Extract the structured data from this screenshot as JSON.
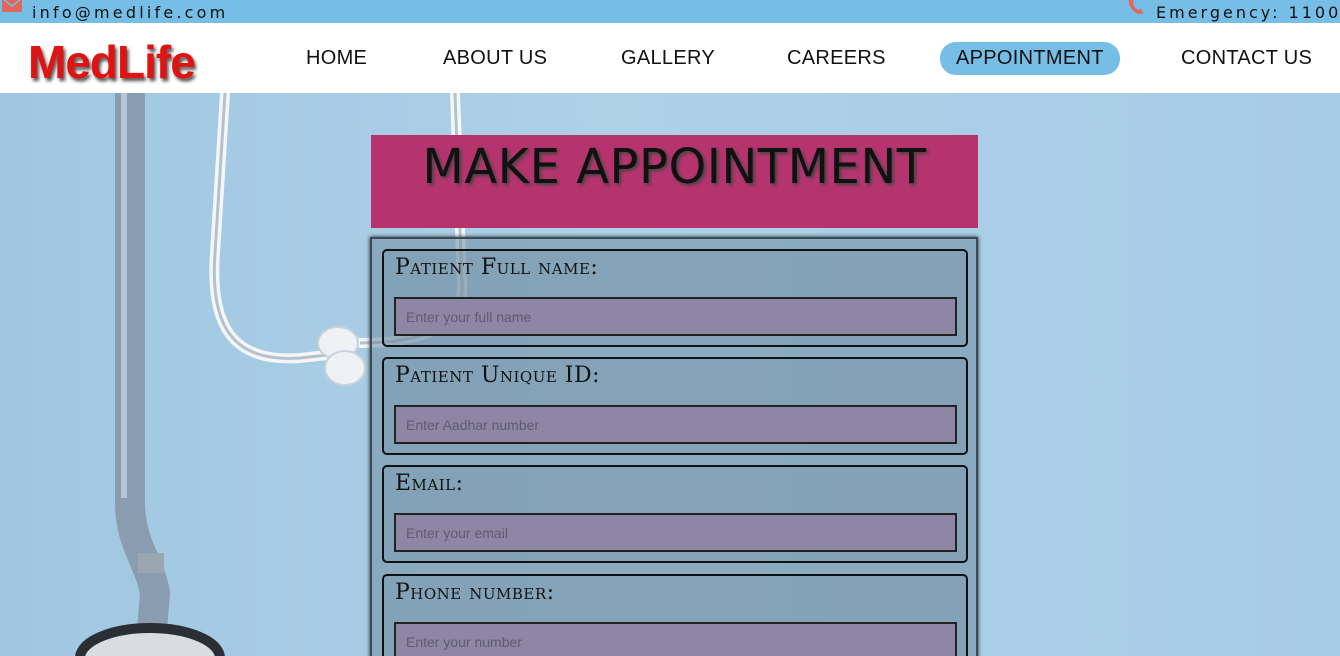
{
  "topbar": {
    "email": "info@medlife.com",
    "emergency": "Emergency: 1100",
    "mail_icon": "mail-icon",
    "phone_icon": "phone-icon"
  },
  "brand": {
    "name": "MedLife"
  },
  "nav": {
    "items": [
      {
        "label": "HOME"
      },
      {
        "label": "ABOUT US"
      },
      {
        "label": "GALLERY"
      },
      {
        "label": "CAREERS"
      },
      {
        "label": "APPOINTMENT",
        "active": true
      },
      {
        "label": "CONTACT US"
      }
    ],
    "active_color": "#76bee6"
  },
  "page": {
    "title": "MAKE APPOINTMENT",
    "title_bg": "#b6346e"
  },
  "form": {
    "fields": [
      {
        "label": "Patient Full name:",
        "placeholder": "Enter your full name",
        "value": ""
      },
      {
        "label": "Patient Unique ID:",
        "placeholder": "Enter Aadhar number",
        "value": ""
      },
      {
        "label": "Email:",
        "placeholder": "Enter your email",
        "value": ""
      },
      {
        "label": "Phone number:",
        "placeholder": "Enter your number",
        "value": ""
      }
    ]
  }
}
